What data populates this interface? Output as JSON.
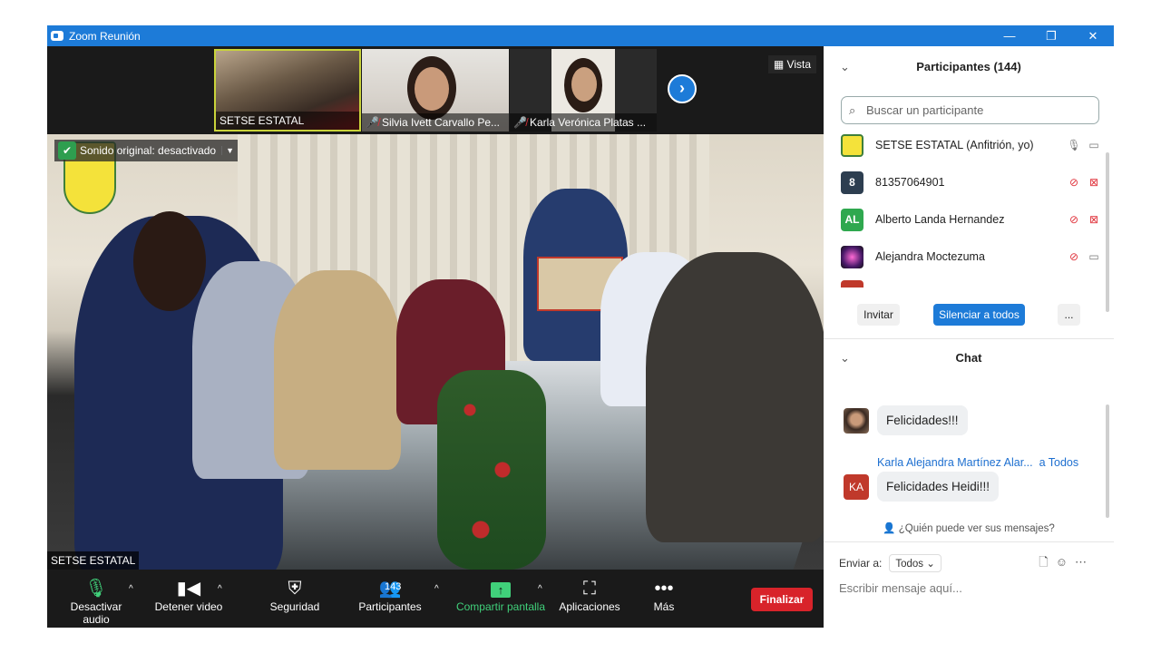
{
  "window": {
    "title": "Zoom Reunión",
    "controls": [
      "—",
      "❐",
      "✕"
    ]
  },
  "thumbnails": [
    {
      "name": "SETSE ESTATAL",
      "muted": false
    },
    {
      "name": "Silvia Ivett Carvallo Pe...",
      "muted": true
    },
    {
      "name": "Karla Verónica Platas ...",
      "muted": true
    }
  ],
  "view_label": "Vista",
  "video": {
    "original_sound": "Sonido original: desactivado",
    "speaker_name": "SETSE ESTATAL"
  },
  "toolbar": {
    "mute": "Desactivar audio",
    "video": "Detener video",
    "security": "Seguridad",
    "participants": "Participantes",
    "participant_count": "143",
    "share": "Compartir pantalla",
    "apps": "Aplicaciones",
    "more": "Más",
    "end": "Finalizar"
  },
  "participants_panel": {
    "title": "Participantes (144)",
    "search_placeholder": "Buscar un participante",
    "items": [
      {
        "name": "SETSE ESTATAL (Anfitrión, yo)",
        "avatar": "",
        "avatar_color": "#f4e23a"
      },
      {
        "name": "81357064901",
        "avatar": "8",
        "avatar_color": "#2d3e50"
      },
      {
        "name": "Alberto Landa Hernandez",
        "avatar": "AL",
        "avatar_color": "#2fa84f"
      },
      {
        "name": "Alejandra Moctezuma",
        "avatar": "",
        "avatar_color": "#4a1a6a"
      }
    ],
    "invite": "Invitar",
    "mute_all": "Silenciar a todos",
    "more": "..."
  },
  "chat": {
    "title": "Chat",
    "messages": [
      {
        "text": "Felicidades!!!"
      },
      {
        "sender": "Karla Alejandra Martínez Alar...",
        "to": "a Todos",
        "avatar": "KA",
        "text": "Felicidades Heidi!!!"
      }
    ],
    "who_can_see": "¿Quién puede ver sus mensajes?",
    "send_to_label": "Enviar a:",
    "send_to_value": "Todos",
    "compose_placeholder": "Escribir mensaje aquí..."
  }
}
